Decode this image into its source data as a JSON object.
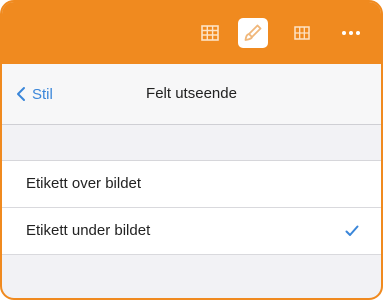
{
  "nav": {
    "back_label": "Stil",
    "title": "Felt utseende"
  },
  "toolbar": {
    "icons": [
      "table-icon",
      "paintbrush-icon",
      "grid-icon",
      "more-icon"
    ],
    "active_icon": "paintbrush-icon"
  },
  "options": [
    {
      "label": "Etikett over bildet",
      "selected": false
    },
    {
      "label": "Etikett under bildet",
      "selected": true
    }
  ],
  "colors": {
    "accent": "#f08a1f",
    "link": "#3a86d9",
    "background": "#f2f2f5"
  }
}
